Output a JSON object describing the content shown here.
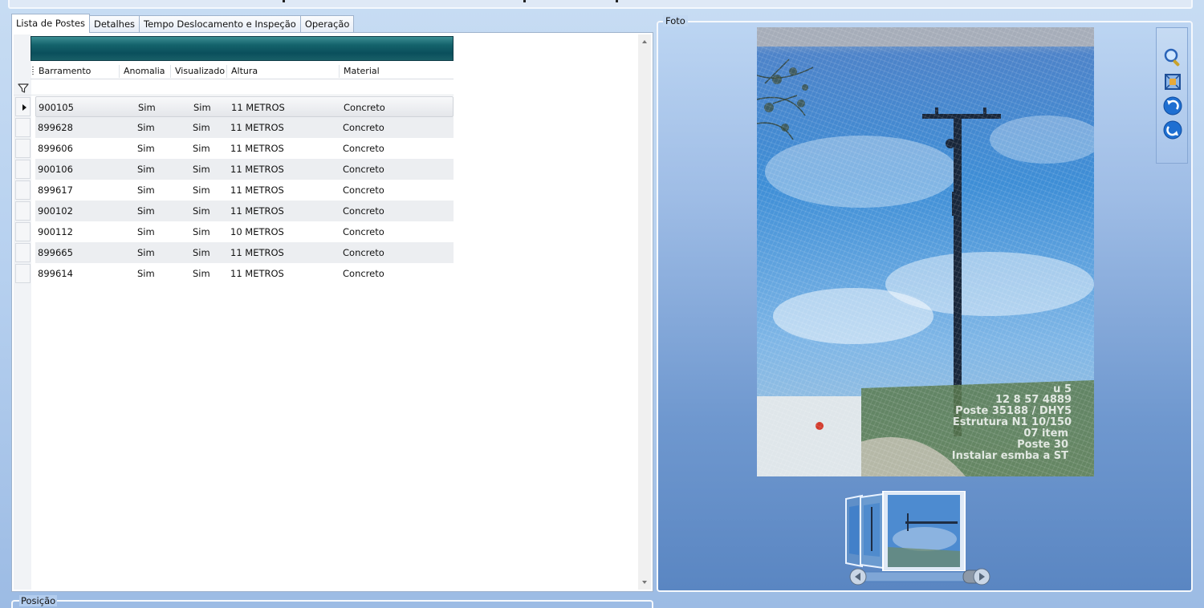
{
  "tabs": [
    {
      "label": "Lista de Postes",
      "active": true
    },
    {
      "label": "Detalhes",
      "active": false
    },
    {
      "label": "Tempo Deslocamento e Inspeção",
      "active": false
    },
    {
      "label": "Operação",
      "active": false
    }
  ],
  "grid": {
    "columns": [
      "Barramento",
      "Anomalia",
      "Visualizado",
      "Altura",
      "Material"
    ],
    "rows": [
      {
        "barramento": "900105",
        "anomalia": "Sim",
        "visualizado": "Sim",
        "altura": "11 METROS",
        "material": "Concreto",
        "selected": true
      },
      {
        "barramento": "899628",
        "anomalia": "Sim",
        "visualizado": "Sim",
        "altura": "11 METROS",
        "material": "Concreto"
      },
      {
        "barramento": "899606",
        "anomalia": "Sim",
        "visualizado": "Sim",
        "altura": "11 METROS",
        "material": "Concreto"
      },
      {
        "barramento": "900106",
        "anomalia": "Sim",
        "visualizado": "Sim",
        "altura": "11 METROS",
        "material": "Concreto"
      },
      {
        "barramento": "899617",
        "anomalia": "Sim",
        "visualizado": "Sim",
        "altura": "11 METROS",
        "material": "Concreto"
      },
      {
        "barramento": "900102",
        "anomalia": "Sim",
        "visualizado": "Sim",
        "altura": "11 METROS",
        "material": "Concreto"
      },
      {
        "barramento": "900112",
        "anomalia": "Sim",
        "visualizado": "Sim",
        "altura": "10 METROS",
        "material": "Concreto"
      },
      {
        "barramento": "899665",
        "anomalia": "Sim",
        "visualizado": "Sim",
        "altura": "11 METROS",
        "material": "Concreto"
      },
      {
        "barramento": "899614",
        "anomalia": "Sim",
        "visualizado": "Sim",
        "altura": "11 METROS",
        "material": "Concreto"
      }
    ]
  },
  "foto": {
    "label": "Foto",
    "photo_stamp": [
      "u 5",
      "12 8 57 4889",
      "Poste 35188 / DHY5",
      "Estrutura N1 10/150",
      "07 item",
      "Poste 30",
      "Instalar esmba a ST"
    ]
  },
  "toolbar": {
    "icons": [
      "zoom-icon",
      "fit-to-window-icon",
      "rotate-left-icon",
      "rotate-right-icon"
    ]
  },
  "posicao": {
    "label": "Posição"
  },
  "colors": {
    "group_bar": "#14626b",
    "panel_bg": "#9fbde6",
    "accent_blue": "#1f6fd1"
  }
}
